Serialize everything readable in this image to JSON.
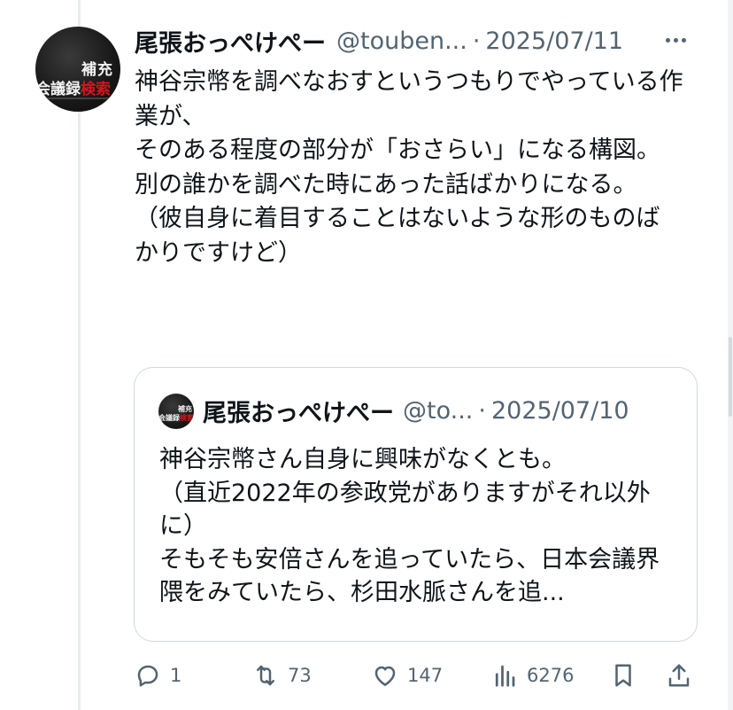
{
  "tweet": {
    "author_name": "尾張おっぺけぺー",
    "handle": "@touben...",
    "separator": "·",
    "date": "2025/07/11",
    "avatar": {
      "line1": "補充",
      "line2_white": "会議録",
      "line2_red": "検索"
    },
    "text": "神谷宗幣を調べなおすというつもりでやっている作業が、\nそのある程度の部分が「おさらい」になる構図。\n別の誰かを調べた時にあった話ばかりになる。\n（彼自身に着目することはないような形のものばかりですけど）"
  },
  "quote": {
    "author_name": "尾張おっぺけぺー",
    "handle": "@to...",
    "separator": "·",
    "date": "2025/07/10",
    "avatar": {
      "line1": "補充",
      "line2_white": "会議録",
      "line2_red": "検索"
    },
    "text": "神谷宗幣さん自身に興味がなくとも。\n（直近2022年の参政党がありますがそれ以外に）\nそもそも安倍さんを追っていたら、日本会議界隈をみていたら、杉田水脈さんを追..."
  },
  "actions": {
    "reply_count": "1",
    "retweet_count": "73",
    "like_count": "147",
    "views_count": "6276",
    "icons": [
      "reply-icon",
      "retweet-icon",
      "like-icon",
      "views-icon",
      "bookmark-icon",
      "share-icon"
    ]
  },
  "colors": {
    "text": "#0f1419",
    "secondary": "#536471",
    "border": "#cfd9de",
    "avatar_red": "#d8141c"
  }
}
